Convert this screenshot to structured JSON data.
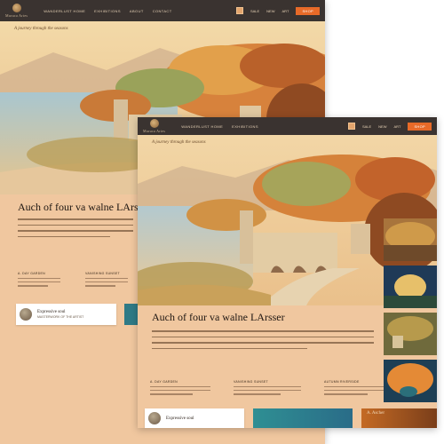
{
  "back_window": {
    "logo_text": "Maruca Artes",
    "nav": [
      "WANDERLUST HOME",
      "EXHIBITIONS",
      "ABOUT",
      "CONTACT"
    ],
    "tools": [
      "SALE",
      "NEW",
      "ART"
    ],
    "cta": "SHOP",
    "hero_caption": "A journey through the seasons",
    "title": "Auch of four va walne LArsser",
    "columns": [
      {
        "heading": "A. DAY GARDEN"
      },
      {
        "heading": "VANISHING SUNSET"
      }
    ],
    "card": {
      "title": "Expressive soul",
      "subtitle": "MASTERWORK OF THE ARTIST"
    }
  },
  "front_window": {
    "logo_text": "Maruca Artes",
    "nav": [
      "WANDERLUST HOME",
      "EXHIBITIONS"
    ],
    "tools": [
      "SALE",
      "NEW",
      "ART"
    ],
    "cta": "SHOP",
    "hero_caption": "A journey through the seasons",
    "title": "Auch of four va walne LArsser",
    "columns": [
      {
        "heading": "A. DAY GARDEN"
      },
      {
        "heading": "VANISHING SUNSET"
      },
      {
        "heading": "AUTUMN RIVERSIDE"
      }
    ],
    "card": {
      "title": "Expressive soul"
    },
    "bottom_tile_label": "A. Ascher"
  },
  "colors": {
    "page_bg": "#f0c79f",
    "topbar": "#3a3330",
    "cta": "#e86a28"
  }
}
